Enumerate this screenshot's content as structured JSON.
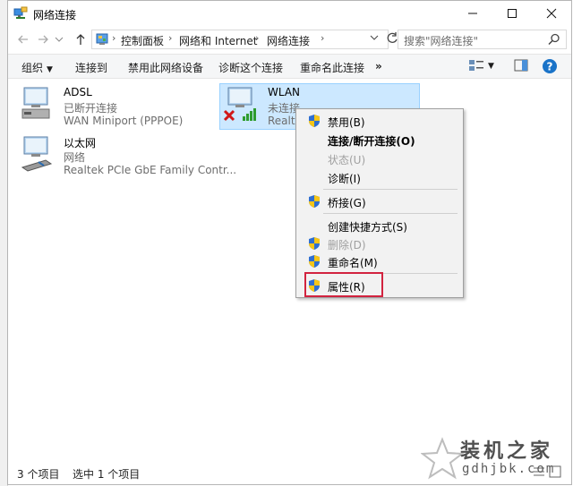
{
  "window": {
    "title": "网络连接"
  },
  "address": {
    "crumbs": [
      "控制面板",
      "网络和 Internet",
      "网络连接"
    ],
    "search_placeholder": "搜索\"网络连接\""
  },
  "toolbar": {
    "organize": "组织",
    "connect_to": "连接到",
    "disable_device": "禁用此网络设备",
    "diagnose": "诊断这个连接",
    "rename": "重命名此连接",
    "more": "»"
  },
  "connections": [
    {
      "name": "ADSL",
      "status": "已断开连接",
      "device": "WAN Miniport (PPPOE)"
    },
    {
      "name": "WLAN",
      "status": "未连接",
      "device": "Realtek"
    },
    {
      "name": "以太网",
      "status": "网络",
      "device": "Realtek PCIe GbE Family Contr..."
    }
  ],
  "context_menu": {
    "disable": "禁用(B)",
    "connect_disconnect": "连接/断开连接(O)",
    "status": "状态(U)",
    "diagnose": "诊断(I)",
    "bridge": "桥接(G)",
    "create_shortcut": "创建快捷方式(S)",
    "delete": "删除(D)",
    "rename": "重命名(M)",
    "properties": "属性(R)"
  },
  "statusbar": {
    "item_count": "3 个项目",
    "selected": "选中 1 个项目"
  },
  "watermark": {
    "cn": "装机之家",
    "en": "gdhjbk.com"
  },
  "colors": {
    "selection": "#cce8ff",
    "highlight_box": "#d2233f",
    "help": "#1a73c8"
  }
}
